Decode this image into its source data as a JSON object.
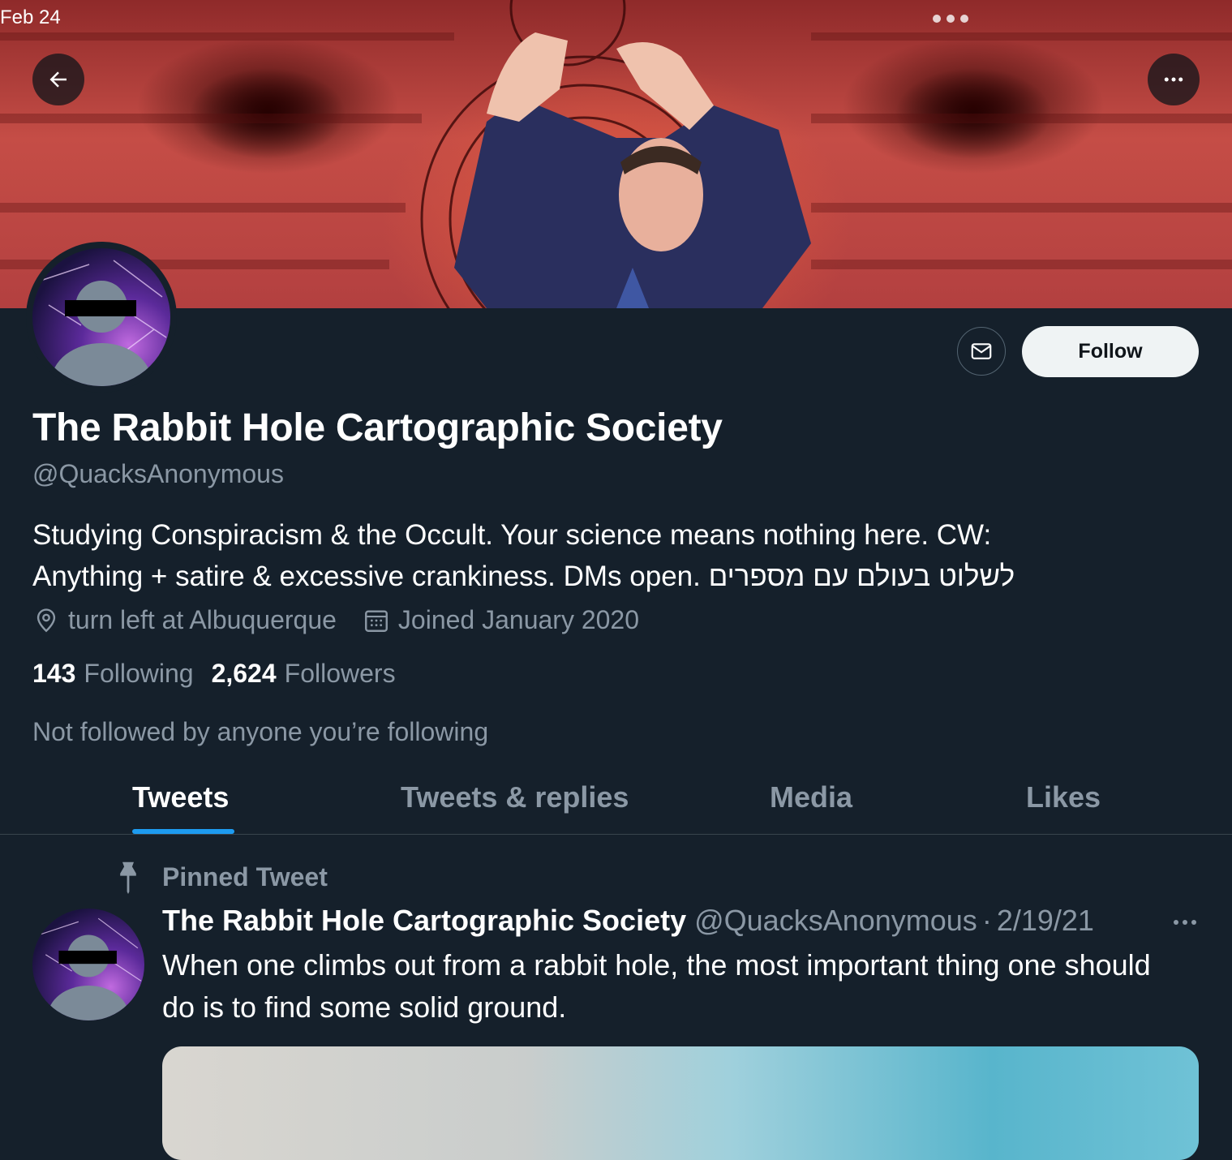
{
  "status_bar": {
    "date": "Feb 24"
  },
  "profile": {
    "display_name": "The Rabbit Hole Cartographic Society",
    "handle": "@QuacksAnonymous",
    "bio": "Studying Conspiracism & the Occult. Your science means nothing here. CW: Anything + satire & excessive crankiness. DMs open. לשלוט בעולם עם מספרים",
    "location": "turn left at Albuquerque",
    "joined": "Joined January 2020",
    "following_count": "143",
    "following_label": "Following",
    "followers_count": "2,624",
    "followers_label": "Followers",
    "not_followed_text": "Not followed by anyone you’re following"
  },
  "actions": {
    "follow_label": "Follow"
  },
  "tabs": [
    {
      "label": "Tweets",
      "active": true
    },
    {
      "label": "Tweets & replies",
      "active": false
    },
    {
      "label": "Media",
      "active": false
    },
    {
      "label": "Likes",
      "active": false
    }
  ],
  "pinned_tweet": {
    "label": "Pinned Tweet",
    "author_name": "The Rabbit Hole Cartographic Society",
    "author_handle": "@QuacksAnonymous",
    "separator": "·",
    "date": "2/19/21",
    "text": "When one climbs out from a rabbit hole, the most important thing one should do is to find some solid ground."
  },
  "icons": {
    "back": "arrow-left-icon",
    "more": "more-horizontal-icon",
    "message": "envelope-icon",
    "location": "location-pin-icon",
    "calendar": "calendar-icon",
    "pin": "pin-icon"
  },
  "colors": {
    "background": "#15202b",
    "accent": "#1d9bf0",
    "secondary_text": "#8b98a5",
    "follow_button_bg": "#eff3f4"
  }
}
